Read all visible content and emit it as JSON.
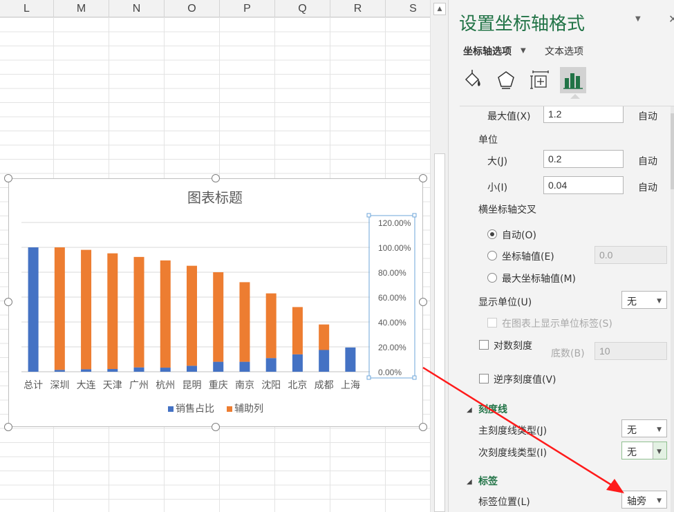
{
  "sheet": {
    "columns": [
      "L",
      "M",
      "N",
      "O",
      "P",
      "Q",
      "R",
      "S"
    ]
  },
  "chart": {
    "title": "图表标题",
    "legend": [
      "销售占比",
      "辅助列"
    ],
    "colors": {
      "sales": "#4472c4",
      "helper": "#ed7d31"
    }
  },
  "chart_data": {
    "type": "bar",
    "stacked": true,
    "title": "图表标题",
    "categories": [
      "总计",
      "深圳",
      "大连",
      "天津",
      "广州",
      "杭州",
      "昆明",
      "重庆",
      "南京",
      "沈阳",
      "北京",
      "成都",
      "上海"
    ],
    "series": [
      {
        "name": "销售占比",
        "color": "#4472c4",
        "values": [
          1.0,
          0.015,
          0.02,
          0.022,
          0.035,
          0.033,
          0.048,
          0.08,
          0.08,
          0.11,
          0.14,
          0.175,
          0.195
        ]
      },
      {
        "name": "辅助列",
        "color": "#ed7d31",
        "values": [
          0,
          0.985,
          0.96,
          0.93,
          0.888,
          0.862,
          0.804,
          0.72,
          0.64,
          0.52,
          0.38,
          0.205,
          0
        ]
      }
    ],
    "y_ticks": [
      "120.00%",
      "100.00%",
      "80.00%",
      "60.00%",
      "40.00%",
      "20.00%",
      "0.00%"
    ],
    "ylim": [
      0,
      1.2
    ],
    "y_axis_position": "right",
    "gridlines": true,
    "legend_position": "bottom"
  },
  "pane": {
    "title": "设置坐标轴格式",
    "tab_axis": "坐标轴选项",
    "tab_text": "文本选项",
    "icons": [
      "fill-line-icon",
      "effects-icon",
      "size-properties-icon",
      "axis-options-icon"
    ],
    "max_label": "最大值(X)",
    "max_value": "1.2",
    "max_auto": "自动",
    "unit_label": "单位",
    "major_label": "大(J)",
    "major_value": "0.2",
    "major_auto": "自动",
    "minor_label": "小(I)",
    "minor_value": "0.04",
    "minor_auto": "自动",
    "cross_label": "横坐标轴交叉",
    "radio_auto": "自动(O)",
    "radio_axis_value": "坐标轴值(E)",
    "axis_value_input": "0.0",
    "radio_max": "最大坐标轴值(M)",
    "display_unit_label": "显示单位(U)",
    "display_unit_value": "无",
    "show_unit_label": "在图表上显示单位标签(S)",
    "log_scale_label": "对数刻度",
    "base_label": "底数(B)",
    "base_value": "10",
    "reverse_label": "逆序刻度值(V)",
    "ticks_section": "刻度线",
    "major_tick_label": "主刻度线类型(J)",
    "major_tick_value": "无",
    "minor_tick_label": "次刻度线类型(I)",
    "minor_tick_value": "无",
    "labels_section": "标签",
    "label_pos_label": "标签位置(L)",
    "label_pos_value": "轴旁"
  }
}
